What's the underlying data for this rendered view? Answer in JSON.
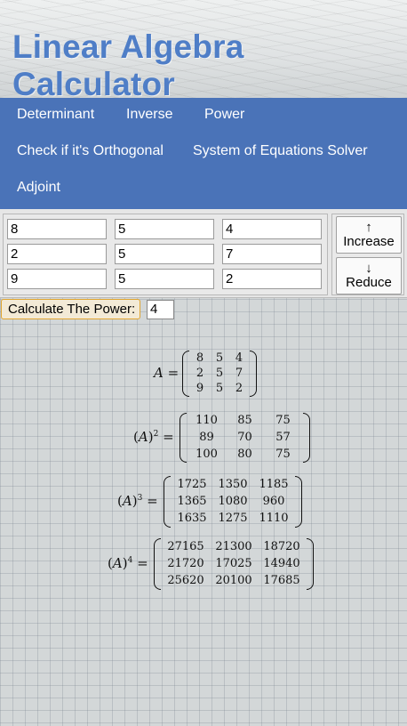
{
  "header": {
    "title": "Linear Algebra Calculator"
  },
  "nav": {
    "items": [
      "Determinant",
      "Inverse",
      "Power",
      "Check if it's Orthogonal",
      "System of Equations Solver",
      "Adjoint"
    ]
  },
  "matrix_input": {
    "rows": [
      [
        "8",
        "5",
        "4"
      ],
      [
        "2",
        "5",
        "7"
      ],
      [
        "9",
        "5",
        "2"
      ]
    ]
  },
  "size_buttons": {
    "increase_arrow": "↑",
    "increase_label": "Increase",
    "reduce_arrow": "↓",
    "reduce_label": "Reduce"
  },
  "power": {
    "button_label": "Calculate The Power:",
    "value": "4"
  },
  "results": [
    {
      "name": "A",
      "exp": "",
      "rows": [
        [
          "8",
          "5",
          "4"
        ],
        [
          "2",
          "5",
          "7"
        ],
        [
          "9",
          "5",
          "2"
        ]
      ]
    },
    {
      "name": "A",
      "exp": "2",
      "rows": [
        [
          "110",
          "85",
          "75"
        ],
        [
          "89",
          "70",
          "57"
        ],
        [
          "100",
          "80",
          "75"
        ]
      ]
    },
    {
      "name": "A",
      "exp": "3",
      "rows": [
        [
          "1725",
          "1350",
          "1185"
        ],
        [
          "1365",
          "1080",
          "960"
        ],
        [
          "1635",
          "1275",
          "1110"
        ]
      ]
    },
    {
      "name": "A",
      "exp": "4",
      "rows": [
        [
          "27165",
          "21300",
          "18720"
        ],
        [
          "21720",
          "17025",
          "14940"
        ],
        [
          "25620",
          "20100",
          "17685"
        ]
      ]
    }
  ],
  "colors": {
    "accent": "#4a73b8",
    "title": "#4f7ec7",
    "power_border": "#e0a531"
  }
}
